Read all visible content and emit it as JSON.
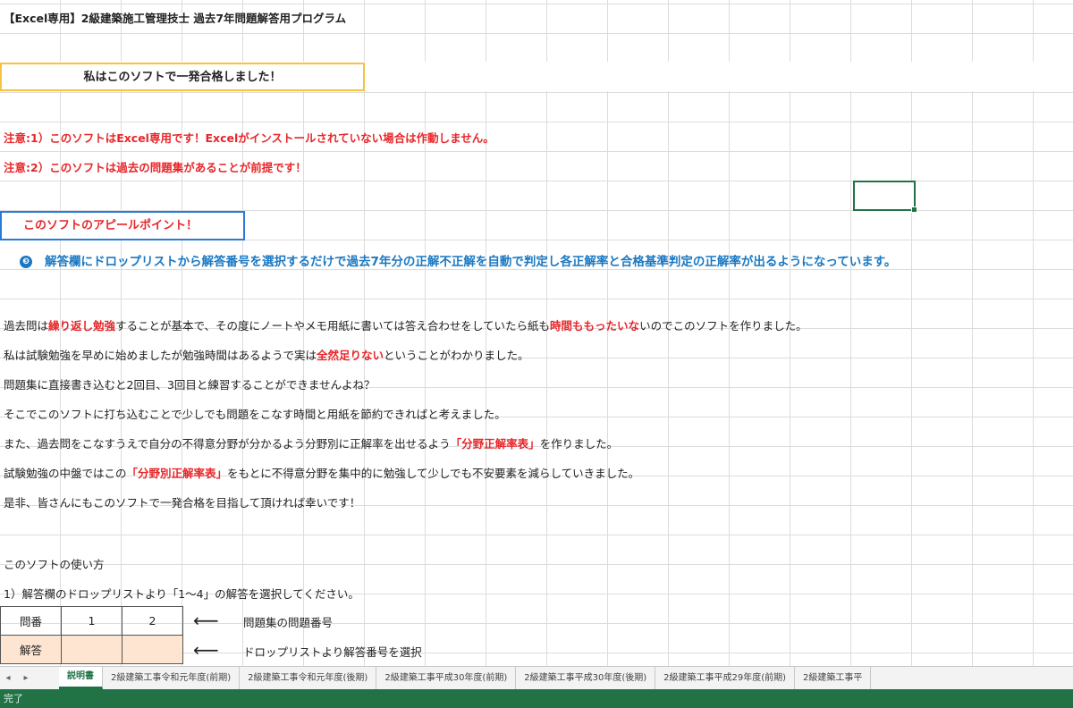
{
  "title": "【Excel専用】2級建築施工管理技士 過去7年問題解答用プログラム",
  "banner": "私はこのソフトで一発合格しました！",
  "notes": [
    "注意:1）このソフトはExcel専用です！Excelがインストールされていない場合は作動しません。",
    "注意:2）このソフトは過去の問題集があることが前提です！"
  ],
  "appeal_box": "このソフトのアピールポイント！",
  "appeal_bullet_icon": "info-bullet-icon",
  "appeal_text": "解答欄にドロップリストから解答番号を選択するだけで過去7年分の正解不正解を自動で判定し各正解率と合格基準判定の正解率が出るようになっています。",
  "paragraphs": {
    "p1": {
      "a": "過去問は",
      "b": "繰り返し勉強",
      "c": "することが基本で、その度にノートやメモ用紙に書いては答え合わせをしていたら紙も",
      "d": "時間ももったいな",
      "e": "いのでこのソフトを作りました。"
    },
    "p2": {
      "a": "私は試験勉強を早めに始めましたが勉強時間はあるようで実は",
      "b": "全然足りない",
      "c": "ということがわかりました。"
    },
    "p3": "問題集に直接書き込むと2回目、3回目と練習することができませんよね？",
    "p4": "そこでこのソフトに打ち込むことで少しでも問題をこなす時間と用紙を節約できればと考えました。",
    "p5": {
      "a": "また、過去問をこなすうえで自分の不得意分野が分かるよう分野別に正解率を出せるよう",
      "b": "「分野正解率表」",
      "c": "を作りました。"
    },
    "p6": {
      "a": "試験勉強の中盤ではこの",
      "b": "「分野別正解率表」",
      "c": "をもとに不得意分野を集中的に勉強して少しでも不安要素を減らしていきました。"
    },
    "p7": "是非、皆さんにもこのソフトで一発合格を目指して頂ければ幸いです！"
  },
  "usage": {
    "title": "このソフトの使い方",
    "step1": "1）解答欄のドロップリストより「1～4」の解答を選択してください。"
  },
  "example_table": {
    "row1": {
      "label": "問番",
      "v1": "1",
      "v2": "2"
    },
    "row2": {
      "label": "解答",
      "v1": "",
      "v2": ""
    },
    "note1": "問題集の問題番号",
    "note2": "ドロップリストより解答番号を選択",
    "arrow_icon": "left-arrow-icon"
  },
  "tabs": [
    "説明書",
    "2級建築工事令和元年度(前期)",
    "2級建築工事令和元年度(後期)",
    "2級建築工事平成30年度(前期)",
    "2級建築工事平成30年度(後期)",
    "2級建築工事平成29年度(前期)",
    "2級建築工事平"
  ],
  "active_tab": "説明書",
  "nav": {
    "prev": "◂",
    "next": "▸"
  },
  "status": "完了",
  "colors": {
    "accent": "#217346",
    "red": "#e8262a",
    "blue": "#1a78c2",
    "banner_border": "#f5c242",
    "peach": "#fde5d2"
  }
}
